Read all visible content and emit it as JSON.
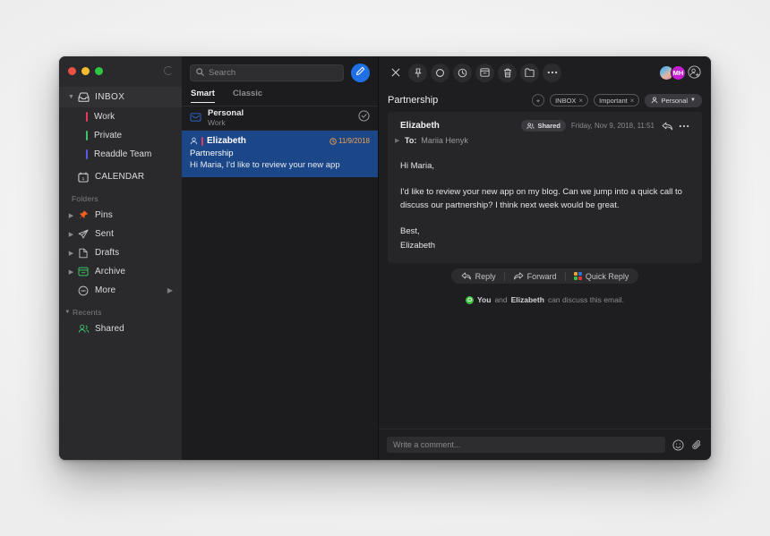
{
  "window": {
    "traffic_lights": [
      "close",
      "minimize",
      "maximize"
    ],
    "colors": {
      "close": "#ed4f43",
      "minimize": "#f5bc2e",
      "maximize": "#30c740",
      "accent_blue": "#1f6fe5",
      "selection_blue": "#1b4789",
      "date_orange": "#f0a04a",
      "tag_work": "#e8385e",
      "tag_private": "#3cc46a",
      "tag_readdle": "#5b5be8",
      "avatar_mh": "#c41fd0",
      "discuss_green": "#3fbf3f"
    }
  },
  "sidebar": {
    "inbox": {
      "label": "INBOX",
      "icon": "inbox-icon",
      "expanded": true
    },
    "inbox_children": [
      {
        "label": "Work",
        "color": "#e8385e"
      },
      {
        "label": "Private",
        "color": "#3cc46a"
      },
      {
        "label": "Readdle Team",
        "color": "#5b5be8"
      }
    ],
    "calendar": {
      "label": "CALENDAR",
      "icon": "calendar-icon"
    },
    "folders_header": "Folders",
    "folders": [
      {
        "label": "Pins",
        "icon": "pin-icon",
        "icon_color": "#f4601e",
        "chevron": true,
        "arrow": false
      },
      {
        "label": "Sent",
        "icon": "sent-icon",
        "icon_color": "#b6b6ba",
        "chevron": true,
        "arrow": false
      },
      {
        "label": "Drafts",
        "icon": "draft-icon",
        "icon_color": "#b6b6ba",
        "chevron": true,
        "arrow": false
      },
      {
        "label": "Archive",
        "icon": "archive-icon",
        "icon_color": "#3cc46a",
        "chevron": true,
        "arrow": false
      },
      {
        "label": "More",
        "icon": "more-circle-icon",
        "icon_color": "#b6b6ba",
        "chevron": false,
        "arrow": true
      }
    ],
    "recents_header": "Recents",
    "recents": [
      {
        "label": "Shared",
        "icon": "shared-people-icon",
        "icon_color": "#3cc46a"
      }
    ]
  },
  "list_panel": {
    "search": {
      "placeholder": "Search",
      "value": "",
      "icon": "search-icon"
    },
    "compose": {
      "icon": "compose-pencil-icon",
      "label": ""
    },
    "tabs": [
      {
        "label": "Smart",
        "active": true
      },
      {
        "label": "Classic",
        "active": false
      }
    ],
    "group": {
      "title": "Personal",
      "subtitle": "Work",
      "icon": "envelope-icon",
      "action_icon": "check-circle-icon"
    },
    "messages": [
      {
        "sender": "Elizabeth",
        "subject": "Partnership",
        "snippet": "Hi Maria, I'd like to review your new app",
        "date": "11/9/2018",
        "date_icon": "clock-icon",
        "sender_icon": "person-icon",
        "selected": true
      }
    ]
  },
  "detail": {
    "toolbar": [
      {
        "name": "close-icon",
        "label": "Close"
      },
      {
        "name": "pin-icon",
        "label": "Pin"
      },
      {
        "name": "unread-circle-icon",
        "label": "Mark unread"
      },
      {
        "name": "clock-icon",
        "label": "Snooze"
      },
      {
        "name": "archive-icon",
        "label": "Archive"
      },
      {
        "name": "trash-icon",
        "label": "Delete"
      },
      {
        "name": "folder-icon",
        "label": "Move to folder"
      },
      {
        "name": "more-icon",
        "label": "More"
      }
    ],
    "avatars": [
      {
        "type": "photo",
        "initials": ""
      },
      {
        "type": "initials",
        "initials": "MH"
      },
      {
        "type": "add",
        "initials": ""
      }
    ],
    "subject": "Partnership",
    "tags": [
      {
        "label": "INBOX",
        "removable": true
      },
      {
        "label": "Important",
        "removable": true
      }
    ],
    "add_tag_label": "+",
    "account_chip": {
      "label": "Personal",
      "icon": "person-icon",
      "caret": "chevron-down-icon"
    },
    "message": {
      "from": "Elizabeth",
      "shared_badge": "Shared",
      "shared_icon": "shared-people-icon",
      "date": "Friday, Nov 9, 2018, 11:51",
      "reply_icon": "reply-arrow-icon",
      "more_icon": "more-icon",
      "to_label": "To:",
      "to_value": "Mariia Henyk",
      "body_paragraphs": [
        "Hi Maria,",
        "I'd like to review your new app on my blog. Can we jump into a quick call to discuss our partnership? I think next week would be great.",
        "Best,\nElizabeth"
      ]
    },
    "actions": [
      {
        "label": "Reply",
        "icon": "reply-arrow-icon"
      },
      {
        "label": "Forward",
        "icon": "forward-arrow-icon"
      },
      {
        "label": "Quick Reply",
        "icon": "quick-reply-grid-icon"
      }
    ],
    "discuss_note": {
      "icon": "chat-bubble-icon",
      "you": "You",
      "and": "and",
      "person": "Elizabeth",
      "tail": "can discuss this email."
    },
    "footer": {
      "comment_placeholder": "Write a comment...",
      "comment_value": "",
      "emoji_icon": "smiley-icon",
      "attach_icon": "paperclip-icon"
    }
  }
}
